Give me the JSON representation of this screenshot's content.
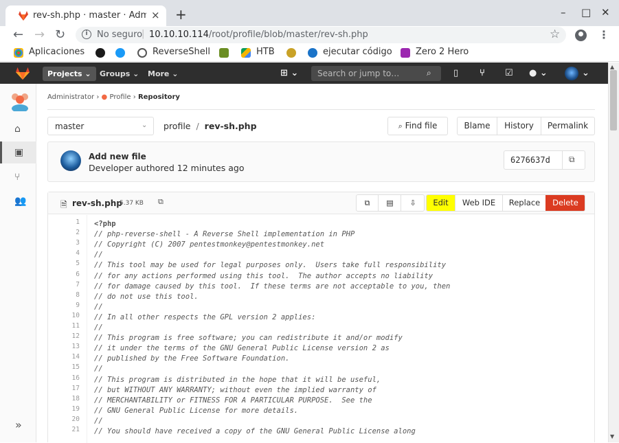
{
  "browser": {
    "tab_title": "rev-sh.php · master · Adm",
    "tab_close": "×",
    "new_tab": "+",
    "win_min": "–",
    "win_max": "□",
    "win_close": "✕",
    "insecure_label": "No seguro",
    "url_host": "10.10.10.114",
    "url_path": "/root/profile/blob/master/rev-sh.php",
    "bookmarks": [
      "Aplicaciones",
      "ReverseShell",
      "HTB",
      "ejecutar código",
      "Zero 2 Hero"
    ]
  },
  "gitlab_header": {
    "projects": "Projects ⌄",
    "groups": "Groups ⌄",
    "more": "More ⌄",
    "search_placeholder": "Search or jump to…"
  },
  "breadcrumb": {
    "admin": "Administrator",
    "project": "Profile",
    "current": "Repository"
  },
  "repo_bar": {
    "branch": "master",
    "path_root": "profile",
    "path_sep": "/",
    "path_file": "rev-sh.php",
    "find_file": "Find file",
    "blame": "Blame",
    "history": "History",
    "permalink": "Permalink"
  },
  "commit": {
    "title": "Add new file",
    "meta": "Developer authored 12 minutes ago",
    "sha": "6276637d"
  },
  "file": {
    "name": "rev-sh.php",
    "size": "5.37 KB",
    "edit": "Edit",
    "web_ide": "Web IDE",
    "replace": "Replace",
    "delete": "Delete"
  },
  "code_lines": [
    "<?php",
    "// php-reverse-shell - A Reverse Shell implementation in PHP",
    "// Copyright (C) 2007 pentestmonkey@pentestmonkey.net",
    "//",
    "// This tool may be used for legal purposes only.  Users take full responsibility",
    "// for any actions performed using this tool.  The author accepts no liability",
    "// for damage caused by this tool.  If these terms are not acceptable to you, then",
    "// do not use this tool.",
    "//",
    "// In all other respects the GPL version 2 applies:",
    "//",
    "// This program is free software; you can redistribute it and/or modify",
    "// it under the terms of the GNU General Public License version 2 as",
    "// published by the Free Software Foundation.",
    "//",
    "// This program is distributed in the hope that it will be useful,",
    "// but WITHOUT ANY WARRANTY; without even the implied warranty of",
    "// MERCHANTABILITY or FITNESS FOR A PARTICULAR PURPOSE.  See the",
    "// GNU General Public License for more details.",
    "//",
    "// You should have received a copy of the GNU General Public License along"
  ],
  "line_numbers": [
    "1",
    "2",
    "3",
    "4",
    "5",
    "6",
    "7",
    "8",
    "9",
    "10",
    "11",
    "12",
    "13",
    "14",
    "15",
    "16",
    "17",
    "18",
    "19",
    "20",
    "21"
  ],
  "colors": {
    "gitlab_header": "#2e2e2e",
    "edit_highlight": "#ffff00",
    "delete_button": "#db3b21",
    "gitlab_orange": "#e24329"
  }
}
